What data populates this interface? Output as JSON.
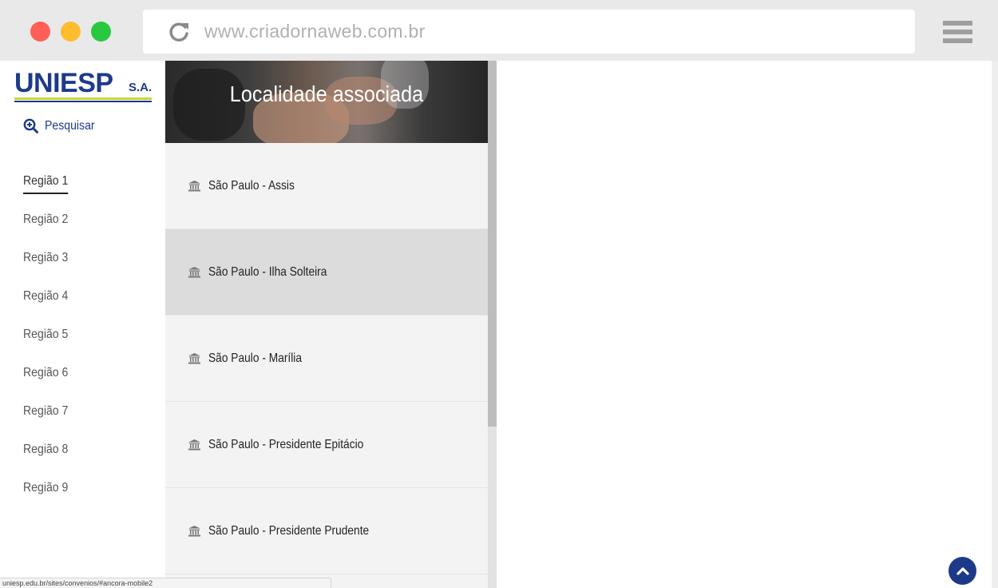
{
  "browser": {
    "url": "www.criadornaweb.com.br",
    "icons": [
      "reload-icon",
      "hamburger-menu-icon"
    ]
  },
  "sidebar": {
    "logo": {
      "text": "UNIESP",
      "suffix": "S.A."
    },
    "search_label": "Pesquisar",
    "regions": [
      {
        "label": "Região 1",
        "active": true
      },
      {
        "label": "Região 2"
      },
      {
        "label": "Região 3"
      },
      {
        "label": "Região 4"
      },
      {
        "label": "Região 5"
      },
      {
        "label": "Região 6"
      },
      {
        "label": "Região 7"
      },
      {
        "label": "Região 8"
      },
      {
        "label": "Região 9"
      }
    ]
  },
  "panel": {
    "title": "Localidade associada",
    "locations": [
      {
        "label": "São Paulo - Assis"
      },
      {
        "label": "São Paulo - Ilha Solteira",
        "selected": true
      },
      {
        "label": "São Paulo - Marília"
      },
      {
        "label": "São Paulo - Presidente Epitácio"
      },
      {
        "label": "São Paulo - Presidente Prudente"
      }
    ]
  },
  "status_url": "uniesp.edu.br/sites/convenios/#ancora-mobile2",
  "colors": {
    "brand_blue": "#1d3a8a",
    "brand_yellow": "#c7d63a",
    "selected_row": "#dcdcdc"
  }
}
